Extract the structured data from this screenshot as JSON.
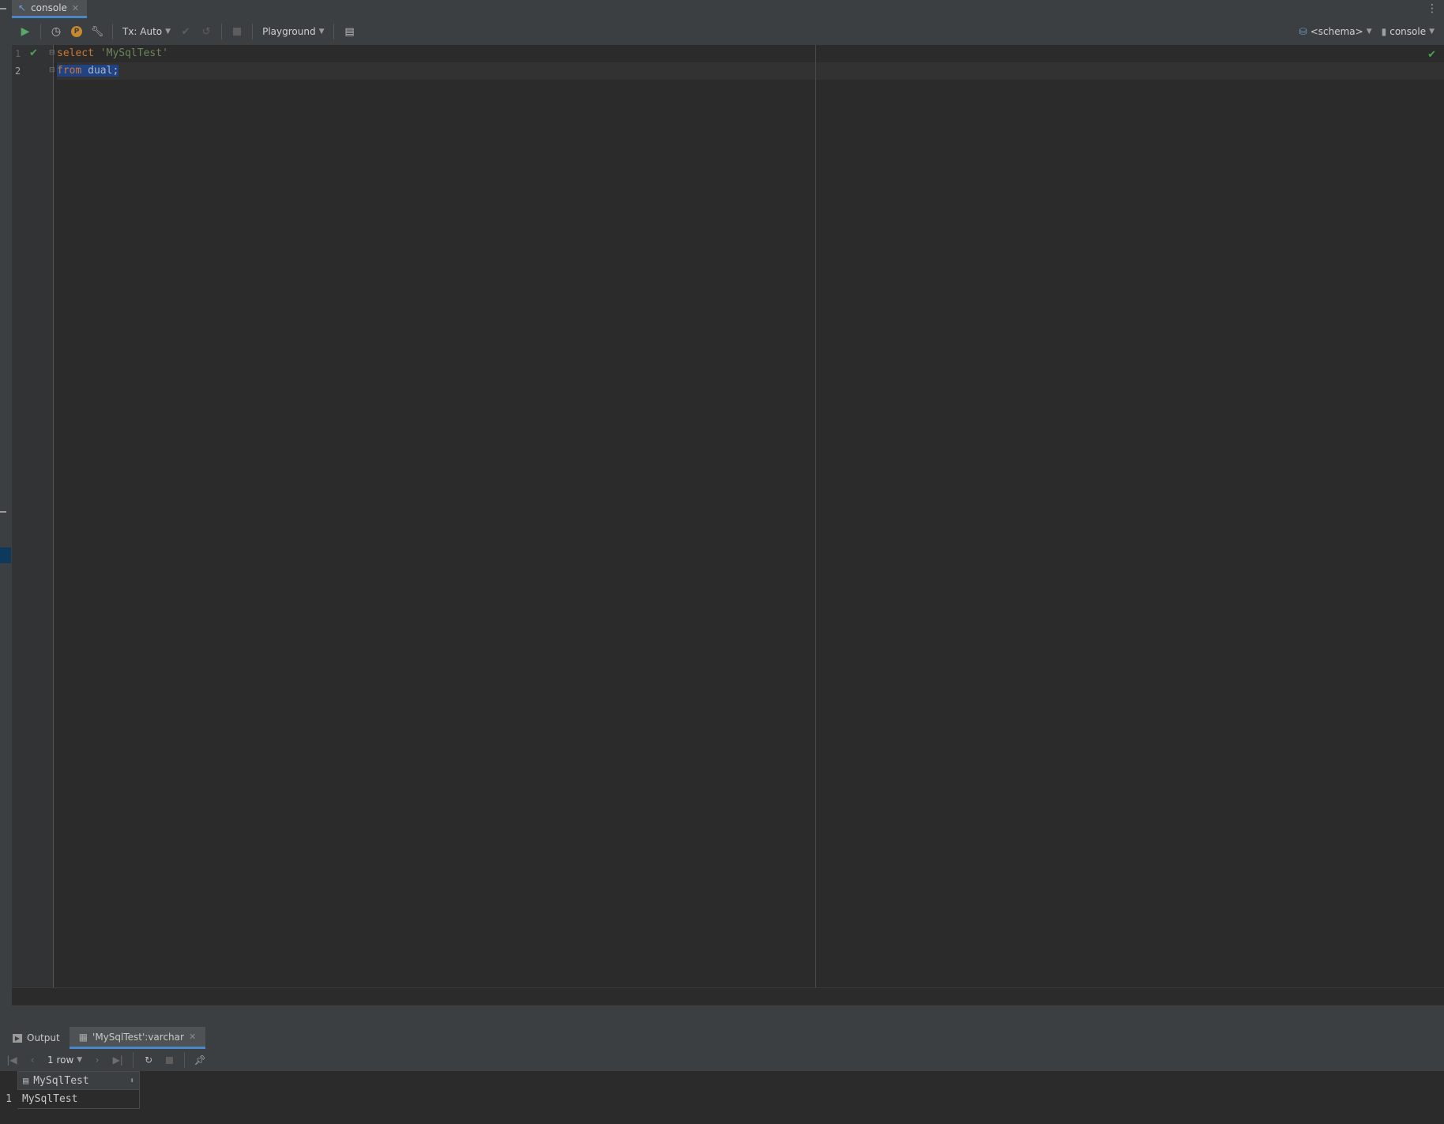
{
  "tab": {
    "label": "console"
  },
  "toolbar": {
    "tx_label": "Tx: Auto",
    "playground_label": "Playground",
    "schema_label": "<schema>",
    "session_label": "console"
  },
  "editor": {
    "line_numbers": [
      "1",
      "2"
    ],
    "line1": {
      "keyword": "select",
      "string": "'MySqlTest'"
    },
    "line2": {
      "keyword": "from",
      "identifier": "dual;"
    }
  },
  "results": {
    "output_tab": "Output",
    "result_tab": "'MySqlTest':varchar",
    "row_count": "1 row",
    "column_header": "MySqlTest",
    "row_number": "1",
    "cell_value": "MySqlTest"
  },
  "colors": {
    "accent": "#4a88c7",
    "keyword": "#cc7832",
    "string": "#6a8759",
    "success": "#4fa34f"
  }
}
